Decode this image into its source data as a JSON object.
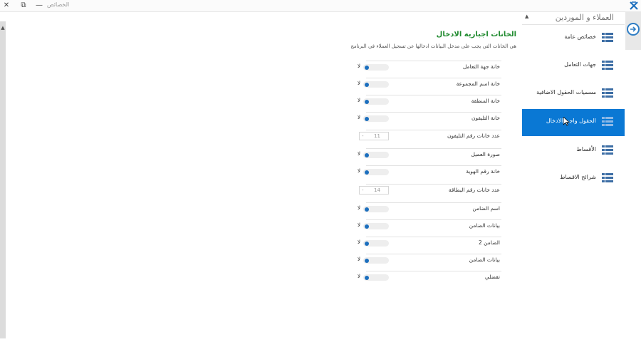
{
  "window": {
    "title": "الخصائص",
    "close": "✕",
    "restore": "⧉",
    "minimize": "—"
  },
  "sidebar": {
    "title": "العملاء و الموردين",
    "items": [
      {
        "label": "خصائص عامة"
      },
      {
        "label": "جهات التعامل"
      },
      {
        "label": "مسميات الحقول الاضافية"
      },
      {
        "label": "الحقول واجبة الادخال"
      },
      {
        "label": "الأقساط"
      },
      {
        "label": "شرائح الاقساط"
      }
    ]
  },
  "main": {
    "title": "الخانات اجبارية الادخال",
    "description": "هي الخانات التي يجب على مدخل البيانات ادخالها عن تسجيل العملاء في البرنامج",
    "rows": [
      {
        "label": "خانة جهة التعامل",
        "value": "لا"
      },
      {
        "label": "خانة اسم المجموعة",
        "value": "لا"
      },
      {
        "label": "خانة المنطقة",
        "value": "لا"
      },
      {
        "label": "خانة التليفون",
        "value": "لا"
      },
      {
        "label": "عدد خانات رقم التليفون",
        "value": "11"
      },
      {
        "label": "صورة العميل",
        "value": "لا"
      },
      {
        "label": "خانة رقم الهوية",
        "value": "لا"
      },
      {
        "label": "عدد خانات رقم البطاقة",
        "value": "14"
      },
      {
        "label": "اسم الضامن",
        "value": "لا"
      },
      {
        "label": "بيانات الضامن",
        "value": "لا"
      },
      {
        "label": "الضامن 2",
        "value": "لا"
      },
      {
        "label": "بيانات الضامن",
        "value": "لا"
      },
      {
        "label": "تفضلي",
        "value": "لا"
      }
    ]
  },
  "colors": {
    "accent": "#0a78d4",
    "title_green": "#1f8a2e",
    "toggle_knob": "#1c6fbe"
  },
  "icons": {
    "back": "arrow-right-circle-icon",
    "menu": "list-icon"
  }
}
